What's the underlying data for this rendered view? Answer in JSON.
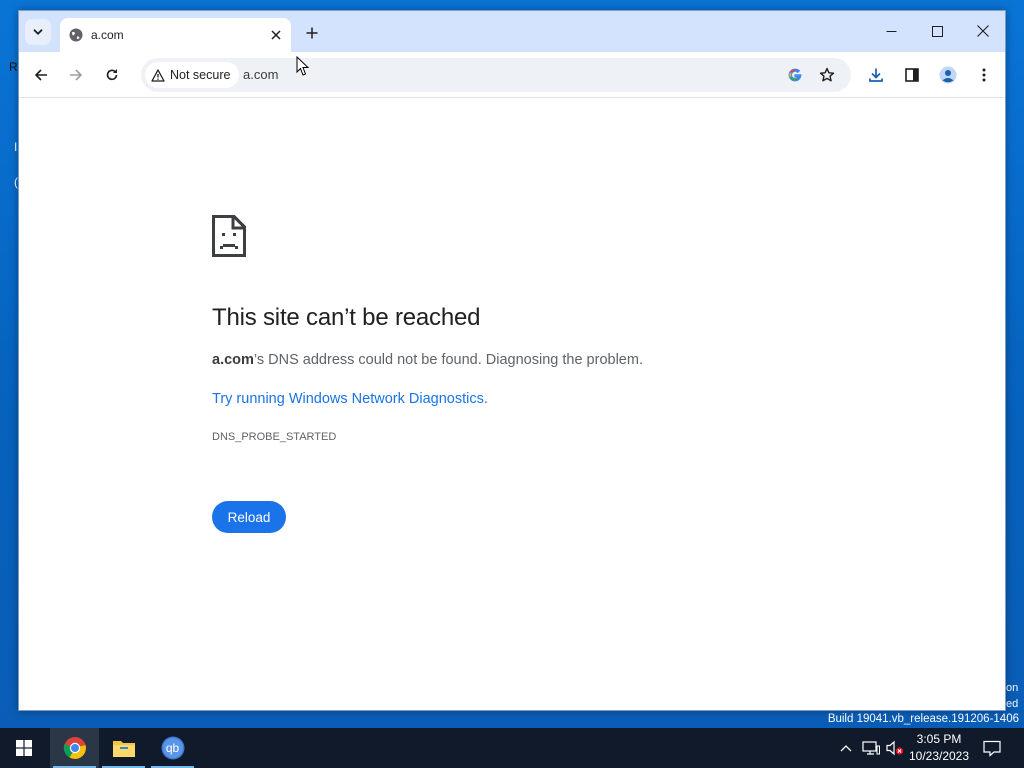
{
  "desktop": {
    "fragments": [
      "R",
      "I",
      "(",
      "on",
      "ed"
    ],
    "build_text": "Build 19041.vb_release.191206-1406"
  },
  "browser": {
    "tab": {
      "title": "a.com"
    },
    "address_bar": {
      "security_label": "Not secure",
      "url": "a.com"
    }
  },
  "error_page": {
    "title": "This site can’t be reached",
    "host": "a.com",
    "message": "’s DNS address could not be found. Diagnosing the problem.",
    "link_text": "Try running Windows Network Diagnostics",
    "link_suffix": ".",
    "error_code": "DNS_PROBE_STARTED",
    "reload_label": "Reload"
  },
  "taskbar": {
    "apps": [
      "chrome",
      "file-explorer",
      "qbittorrent"
    ],
    "qb_label": "qb",
    "time": "3:05 PM",
    "date": "10/23/2023"
  },
  "colors": {
    "accent": "#1a73e8",
    "titlebar": "#d3e3fd",
    "desktop": "#0a6cc9",
    "taskbar": "#101a2a"
  }
}
